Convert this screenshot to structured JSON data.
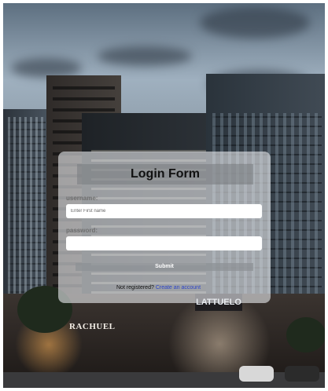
{
  "form": {
    "title": "Login Form",
    "username_label": "username:",
    "username_placeholder": "Enter First name",
    "username_value": "",
    "password_label": "password:",
    "password_value": "",
    "submit_label": "Submit",
    "register_text": "Not registered?",
    "register_link": "Create an account"
  },
  "background": {
    "store_sign_left": "RACHUEL",
    "store_sign_right": "LATTUELO"
  }
}
